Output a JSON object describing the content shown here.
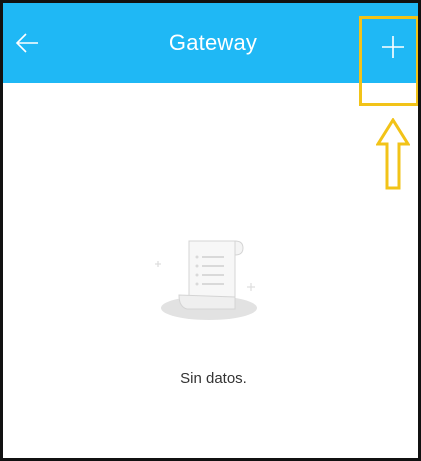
{
  "header": {
    "title": "Gateway",
    "back_icon": "arrow-left-icon",
    "add_icon": "plus-icon",
    "background_color": "#1fb8f5"
  },
  "annotation": {
    "highlight_color": "#f2c318",
    "arrow_icon": "arrow-up-outline-icon"
  },
  "empty_state": {
    "icon": "document-scroll-icon",
    "message": "Sin datos."
  }
}
